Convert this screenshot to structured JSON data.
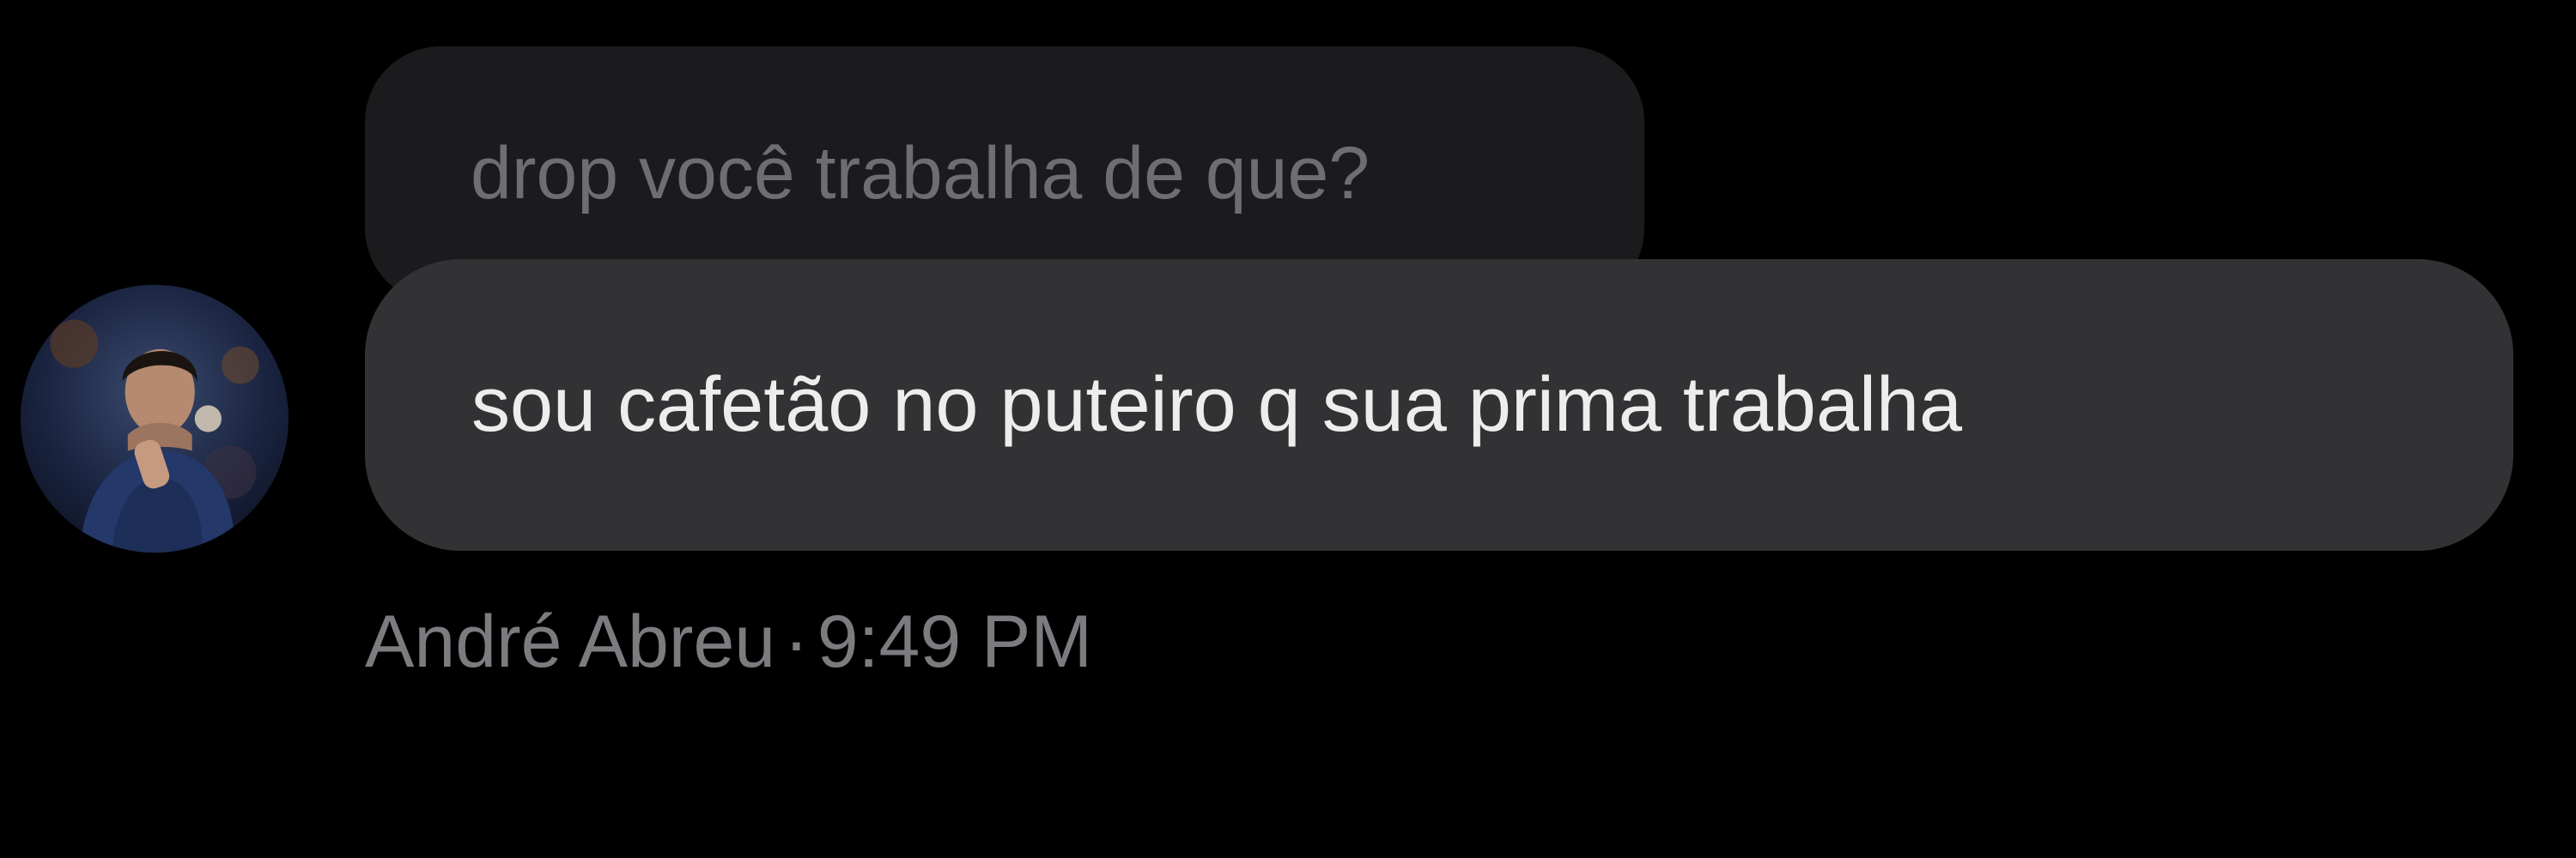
{
  "conversation": {
    "reply_to": {
      "text": "drop você trabalha de que?"
    },
    "message": {
      "text": "sou cafetão no puteiro q sua prima trabalha",
      "sender": "André Abreu",
      "separator": "·",
      "time": "9:49 PM",
      "avatar_icon": "user-avatar-photo"
    }
  },
  "colors": {
    "background": "#000000",
    "quoted_bubble": "#1b1b1d",
    "message_bubble": "#323235",
    "message_text": "#ededed",
    "quoted_text": "#6e6e72",
    "meta_text": "#7c7c80"
  }
}
